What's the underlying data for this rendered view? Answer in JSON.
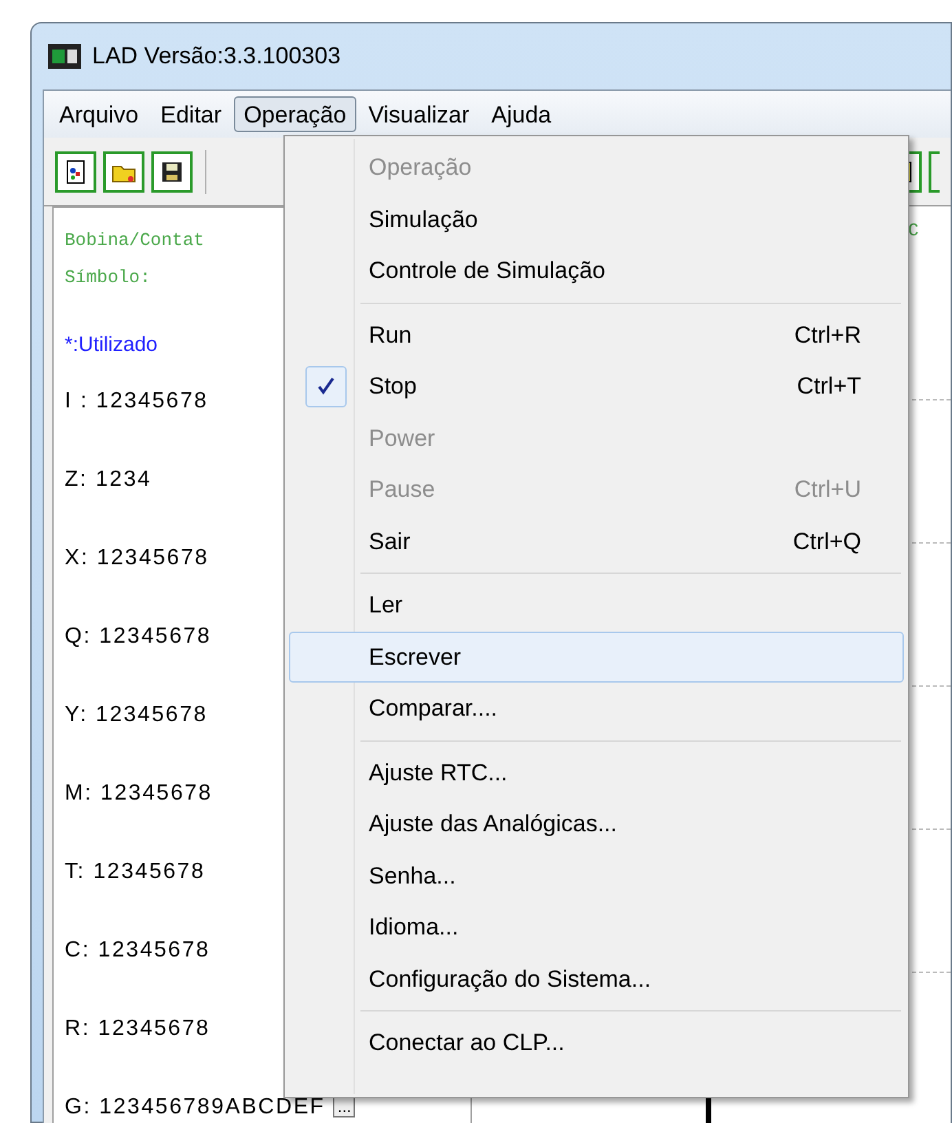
{
  "window": {
    "title": "LAD Versão:3.3.100303"
  },
  "menubar": [
    {
      "label": "Arquivo",
      "selected": false
    },
    {
      "label": "Editar",
      "selected": false
    },
    {
      "label": "Operação",
      "selected": true
    },
    {
      "label": "Visualizar",
      "selected": false
    },
    {
      "label": "Ajuda",
      "selected": false
    }
  ],
  "left_panel": {
    "header_lines": [
      "Bobina/Contat",
      "Símbolo:"
    ],
    "legend": "*:Utilizado",
    "rows": [
      "I : 12345678",
      "Z: 1234",
      "X: 12345678",
      "Q: 12345678",
      "Y: 12345678",
      "M: 12345678",
      "T: 12345678",
      "C: 12345678",
      "R: 12345678",
      "G: 123456789ABCDEF"
    ],
    "more_button": "..."
  },
  "canvas": {
    "label": "C"
  },
  "menu": [
    {
      "kind": "item",
      "label": "Operação",
      "disabled": true,
      "checked": false,
      "selected": false
    },
    {
      "kind": "item",
      "label": "Simulação",
      "disabled": false,
      "checked": false,
      "selected": false
    },
    {
      "kind": "item",
      "label": "Controle de Simulação",
      "disabled": false,
      "checked": false,
      "selected": false
    },
    {
      "kind": "separator"
    },
    {
      "kind": "item",
      "label": "Run",
      "shortcut": "Ctrl+R",
      "disabled": false,
      "checked": false,
      "selected": false
    },
    {
      "kind": "item",
      "label": "Stop",
      "shortcut": "Ctrl+T",
      "disabled": false,
      "checked": true,
      "selected": false
    },
    {
      "kind": "item",
      "label": "Power",
      "disabled": true,
      "checked": false,
      "selected": false
    },
    {
      "kind": "item",
      "label": "Pause",
      "shortcut": "Ctrl+U",
      "disabled": true,
      "checked": false,
      "selected": false
    },
    {
      "kind": "item",
      "label": "Sair",
      "shortcut": "Ctrl+Q",
      "disabled": false,
      "checked": false,
      "selected": false
    },
    {
      "kind": "separator"
    },
    {
      "kind": "item",
      "label": "Ler",
      "disabled": false,
      "checked": false,
      "selected": false
    },
    {
      "kind": "item",
      "label": "Escrever",
      "disabled": false,
      "checked": false,
      "selected": true
    },
    {
      "kind": "item",
      "label": "Comparar....",
      "disabled": false,
      "checked": false,
      "selected": false
    },
    {
      "kind": "separator"
    },
    {
      "kind": "item",
      "label": "Ajuste RTC...",
      "disabled": false,
      "checked": false,
      "selected": false
    },
    {
      "kind": "item",
      "label": "Ajuste das Analógicas...",
      "disabled": false,
      "checked": false,
      "selected": false
    },
    {
      "kind": "item",
      "label": "Senha...",
      "disabled": false,
      "checked": false,
      "selected": false
    },
    {
      "kind": "item",
      "label": "Idioma...",
      "disabled": false,
      "checked": false,
      "selected": false
    },
    {
      "kind": "item",
      "label": "Configuração do Sistema...",
      "disabled": false,
      "checked": false,
      "selected": false
    },
    {
      "kind": "separator"
    },
    {
      "kind": "item",
      "label": "Conectar ao CLP...",
      "disabled": false,
      "checked": false,
      "selected": false
    }
  ]
}
